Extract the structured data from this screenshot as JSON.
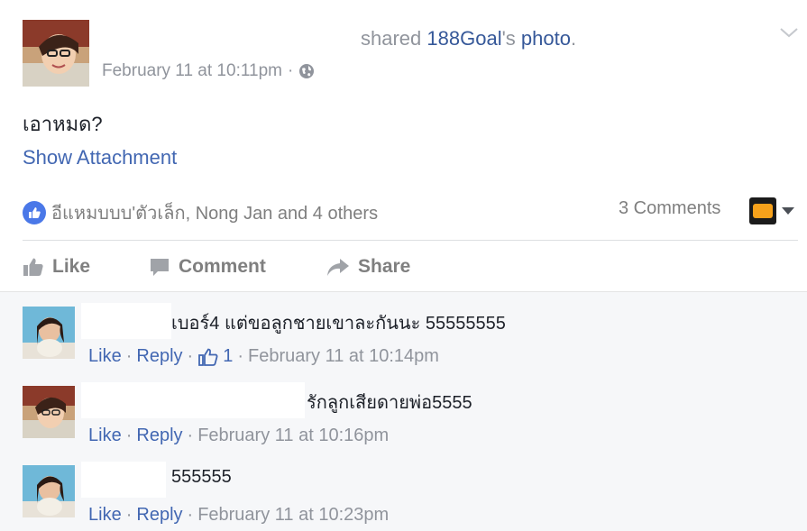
{
  "post": {
    "header_action": "shared",
    "shared_owner": "188Goal",
    "shared_suffix": "'s",
    "shared_object": "photo",
    "period": ".",
    "timestamp": "February 11 at 10:11pm",
    "dot": "·",
    "body": "เอาหมด?",
    "show_attachment": "Show Attachment"
  },
  "reactions": {
    "likers": "อีแหมบบบ'ตัวเล็ก, Nong Jan and 4 others",
    "comments_count": "3 Comments"
  },
  "actions": {
    "like": "Like",
    "comment": "Comment",
    "share": "Share"
  },
  "comments": [
    {
      "text": "เบอร์4 แต่ขอลูกชายเขาละกันนะ 55555555",
      "like": "Like",
      "reply": "Reply",
      "likes": "1",
      "time": "February 11 at 10:14pm"
    },
    {
      "text": "รักลูกเสียดายพ่อ5555",
      "like": "Like",
      "reply": "Reply",
      "time": "February 11 at 10:16pm"
    },
    {
      "text": "555555",
      "like": "Like",
      "reply": "Reply",
      "time": "February 11 at 10:23pm"
    }
  ],
  "colors": {
    "link": "#365899",
    "accent": "#4267b2",
    "meta": "#90949c",
    "comments_bg": "#f6f7f9"
  },
  "icons": {
    "privacy": "globe-icon",
    "menu": "chevron-down-icon",
    "reaction": "like-reaction-icon",
    "like": "thumbs-up-icon",
    "comment": "speech-bubble-icon",
    "share": "share-arrow-icon"
  }
}
